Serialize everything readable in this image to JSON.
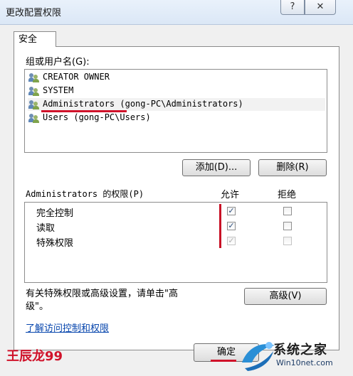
{
  "window": {
    "title": "更改配置权限",
    "help_glyph": "?",
    "close_glyph": "✕"
  },
  "tab": {
    "label": "安全"
  },
  "group": {
    "label": "组或用户名(G):",
    "items": [
      {
        "name": "CREATOR OWNER",
        "icon": "users-icon"
      },
      {
        "name": "SYSTEM",
        "icon": "users-icon"
      },
      {
        "name": "Administrators (gong-PC\\Administrators)",
        "icon": "users-icon",
        "selected": true
      },
      {
        "name": "Users (gong-PC\\Users)",
        "icon": "users-icon"
      }
    ]
  },
  "buttons": {
    "add": "添加(D)...",
    "remove": "删除(R)",
    "advanced": "高级(V)",
    "ok": "确定"
  },
  "permissions": {
    "label": "Administrators 的权限(P)",
    "allow_header": "允许",
    "deny_header": "拒绝",
    "rows": [
      {
        "name": "完全控制",
        "allow": true,
        "deny": false,
        "disabled": false
      },
      {
        "name": "读取",
        "allow": true,
        "deny": false,
        "disabled": false
      },
      {
        "name": "特殊权限",
        "allow": true,
        "deny": false,
        "disabled": true
      }
    ]
  },
  "info": {
    "line1": "有关特殊权限或高级设置，请单击\"高",
    "line2": "级\"。"
  },
  "link": {
    "text": "了解访问控制和权限"
  },
  "watermark": {
    "text": "王辰龙99"
  },
  "branding": {
    "logo_text": "系统之家",
    "logo_url_text": "Win10net.com",
    "accent": "#d0122a"
  }
}
